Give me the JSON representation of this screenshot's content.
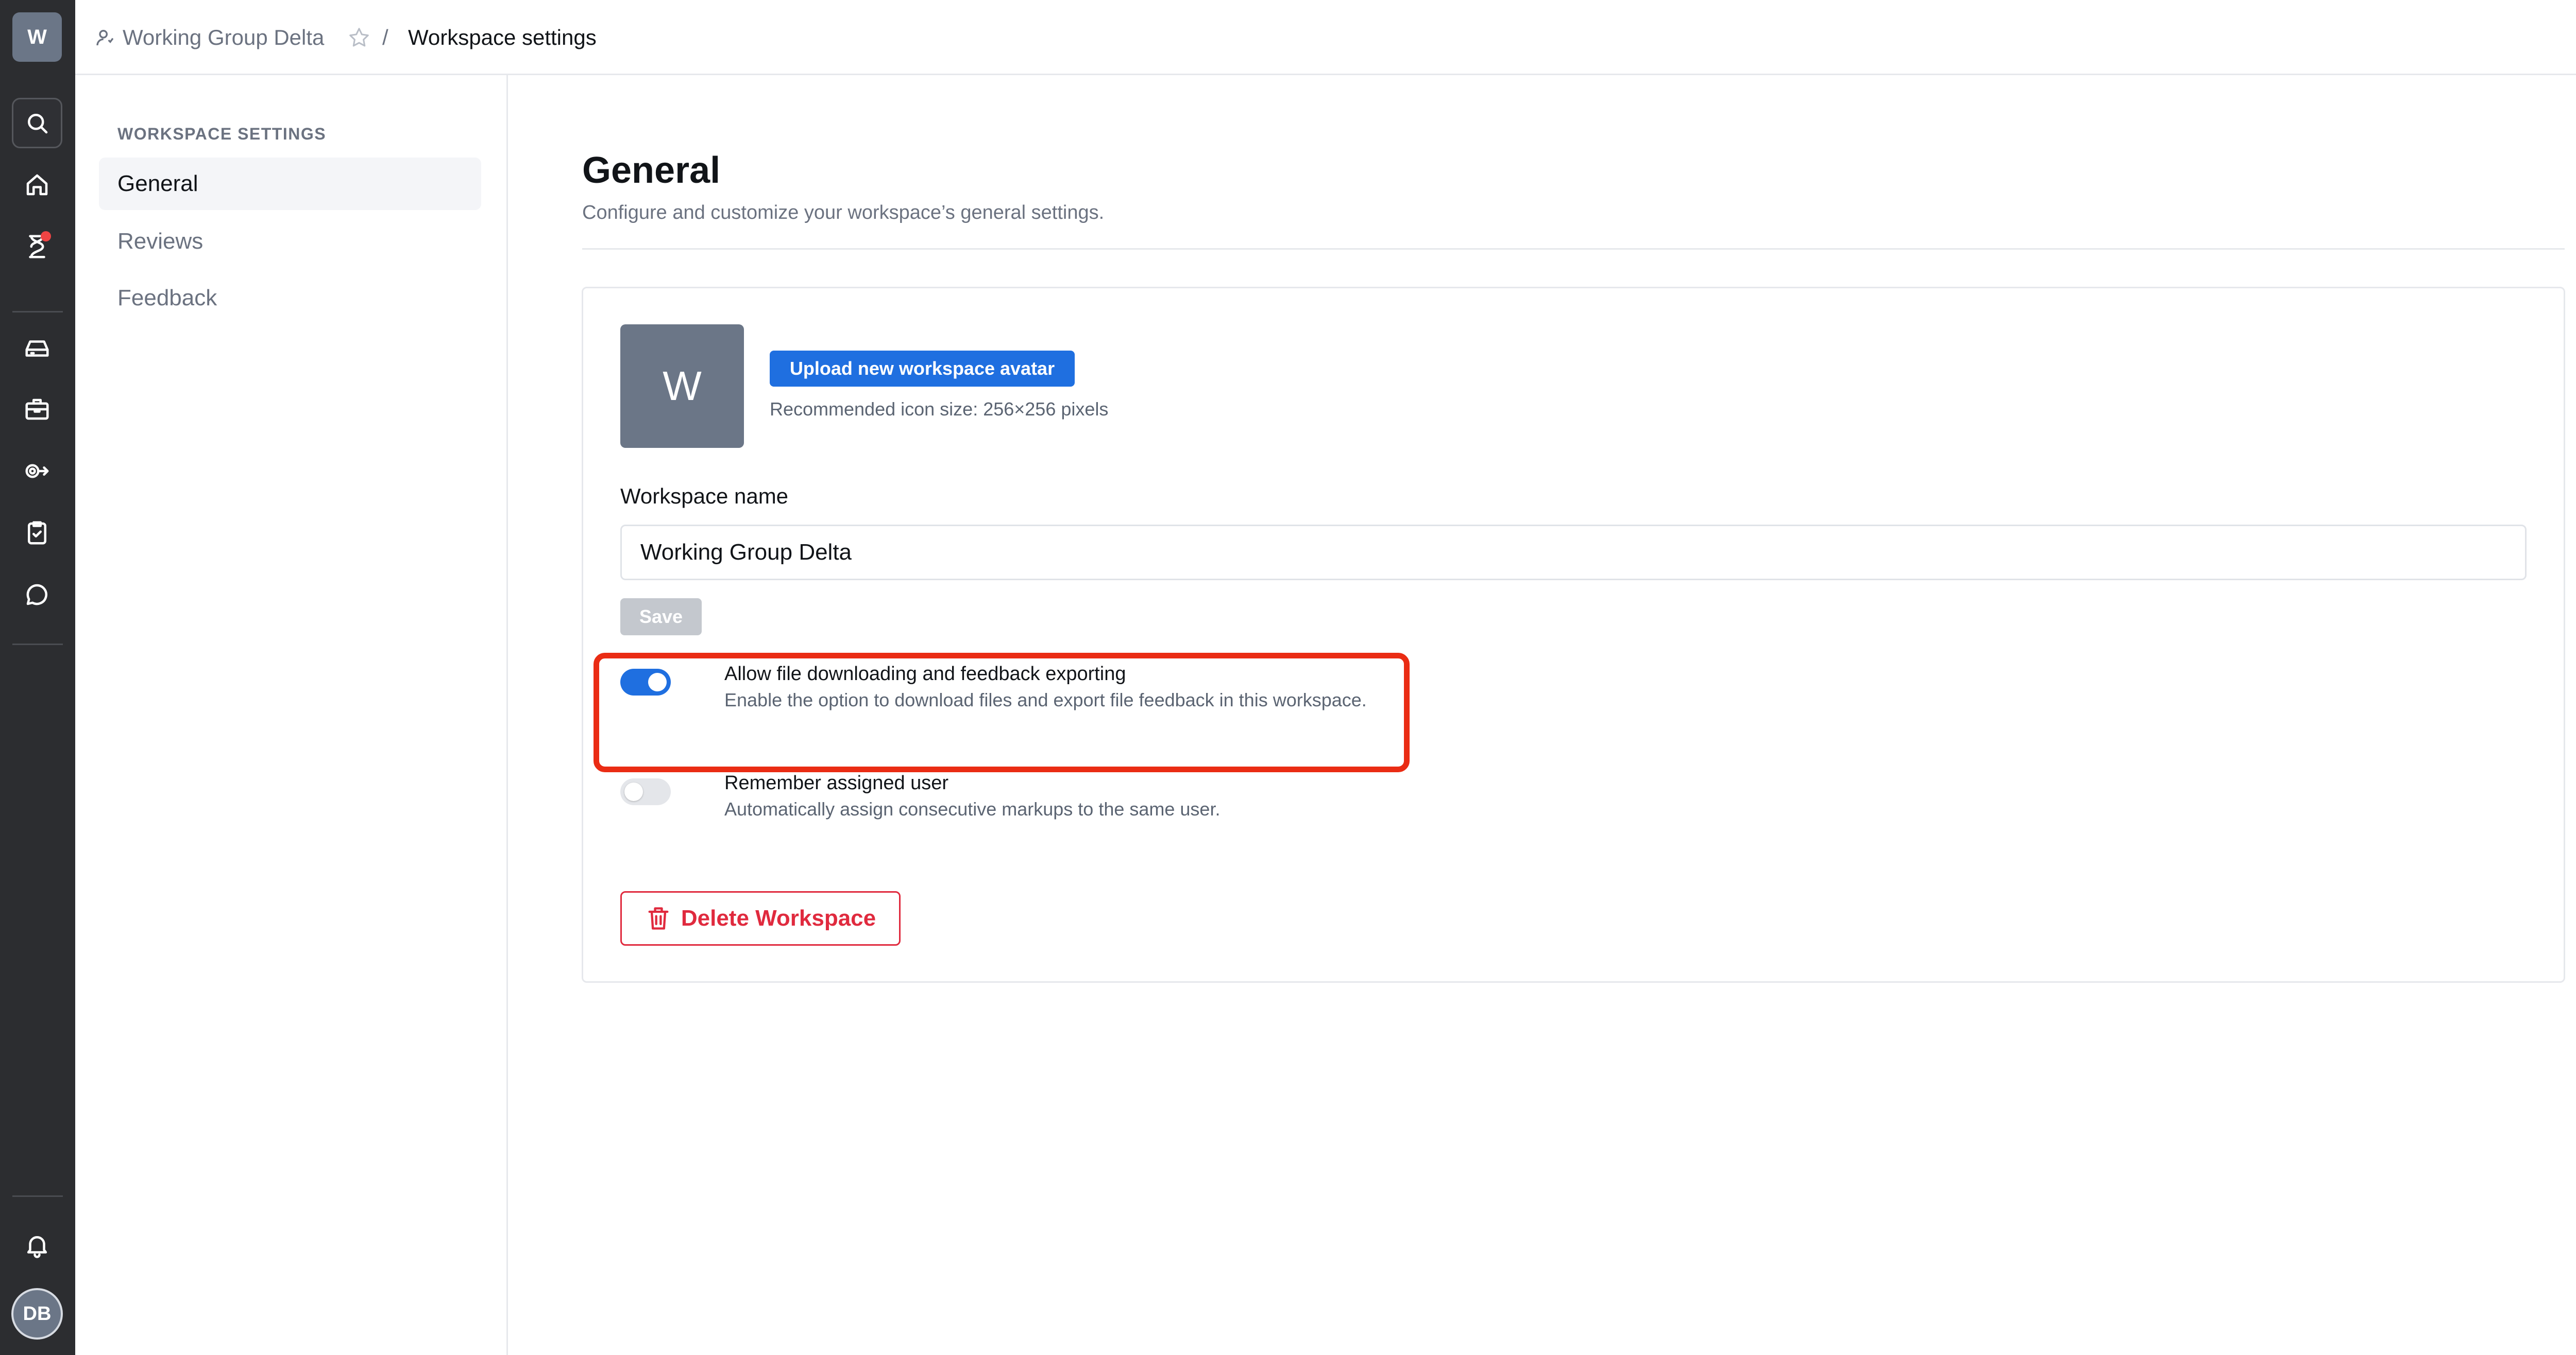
{
  "rail": {
    "workspace_initial": "W",
    "user_initials": "DB",
    "icons": [
      "search-icon",
      "home-icon",
      "hourglass-icon",
      "inbox-icon",
      "briefcase-icon",
      "toggle-arrow-icon",
      "clipboard-check-icon",
      "chat-icon",
      "bell-icon"
    ]
  },
  "breadcrumb": {
    "workspace": "Working Group Delta",
    "separator": "/",
    "current": "Workspace settings"
  },
  "subnav": {
    "heading": "WORKSPACE SETTINGS",
    "items": [
      {
        "label": "General",
        "active": true
      },
      {
        "label": "Reviews",
        "active": false
      },
      {
        "label": "Feedback",
        "active": false
      }
    ]
  },
  "main": {
    "title": "General",
    "subtitle": "Configure and customize your workspace’s general settings.",
    "avatar_initial": "W",
    "upload_label": "Upload new workspace avatar",
    "upload_hint": "Recommended icon size: 256×256 pixels",
    "name_label": "Workspace name",
    "name_value": "Working Group Delta",
    "save_label": "Save",
    "options": [
      {
        "title": "Allow file downloading and feedback exporting",
        "description": "Enable the option to download files and export file feedback in this workspace.",
        "enabled": true
      },
      {
        "title": "Remember assigned user",
        "description": "Automatically assign consecutive markups to the same user.",
        "enabled": false
      }
    ],
    "delete_label": "Delete Workspace"
  },
  "colors": {
    "rail_bg": "#2c2d30",
    "accent": "#1f6fe0",
    "danger": "#e02a3e",
    "highlight": "#ea2c14"
  }
}
